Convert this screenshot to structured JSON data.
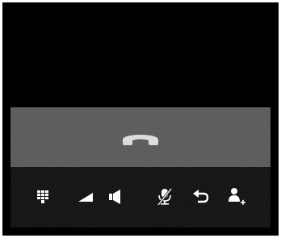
{
  "call": {
    "end_call_button": {
      "icon": "end-call-handset-icon",
      "color": "#dcdcdc",
      "background": "#5c5c5c"
    },
    "controls": [
      {
        "id": "dialpad",
        "icon": "dialpad-icon"
      },
      {
        "id": "audio-level",
        "icon": "signal-wedge-icon"
      },
      {
        "id": "speaker",
        "icon": "speaker-icon"
      },
      {
        "id": "mute",
        "icon": "mic-off-icon"
      },
      {
        "id": "hold",
        "icon": "return-arrow-icon"
      },
      {
        "id": "add-call",
        "icon": "add-person-icon"
      }
    ],
    "icon_color": "#ffffff"
  }
}
